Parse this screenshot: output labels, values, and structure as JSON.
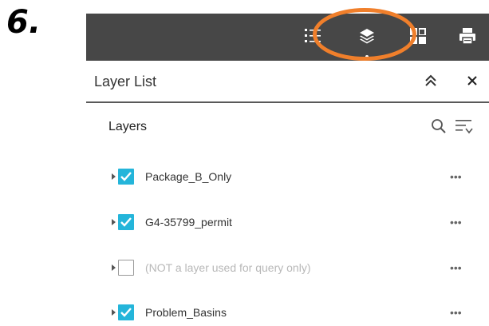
{
  "step_label": "6.",
  "panel": {
    "title": "Layer List",
    "collapse_glyph": "»",
    "close_glyph": "✕"
  },
  "toolbar": {
    "buttons": [
      {
        "icon": "legend-list-icon"
      },
      {
        "icon": "layers-icon",
        "active": true
      },
      {
        "icon": "basemap-gallery-icon"
      },
      {
        "icon": "print-icon"
      }
    ],
    "highlight_color": "#f07f2b"
  },
  "layers_section": {
    "title": "Layers",
    "tools": [
      {
        "icon": "search-icon"
      },
      {
        "icon": "filter-sort-icon"
      }
    ]
  },
  "layers": [
    {
      "name": "Package_B_Only",
      "checked": true
    },
    {
      "name": "G4-35799_permit",
      "checked": true
    },
    {
      "name": "(NOT a layer used for query only)",
      "checked": false
    },
    {
      "name": "Problem_Basins",
      "checked": true
    }
  ],
  "more_glyph": "•••",
  "colors": {
    "toolbar_bg": "#474747",
    "checkbox_checked": "#24b5da",
    "highlight_ring": "#f07f2b"
  }
}
